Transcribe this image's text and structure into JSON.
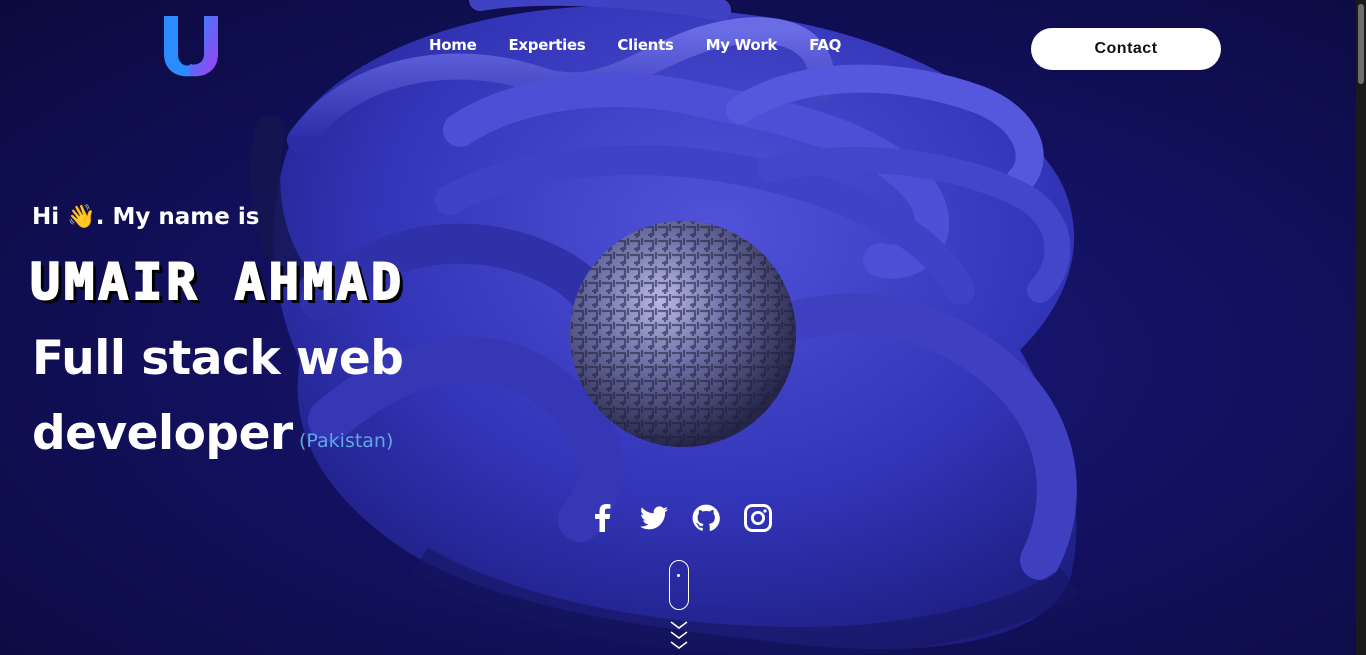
{
  "nav": {
    "items": [
      "Home",
      "Experties",
      "Clients",
      "My Work",
      "FAQ"
    ],
    "contact_label": "Contact"
  },
  "hero": {
    "greeting": "Hi 👋. My name is",
    "name": "UMAIR AHMAD",
    "title_line1": "Full stack web",
    "title_line2": "developer",
    "location": "(Pakistan)"
  },
  "socials": [
    "facebook-icon",
    "twitter-icon",
    "github-icon",
    "instagram-icon"
  ],
  "colors": {
    "background": "#131160",
    "ribbon": "#3a3bc8",
    "accent_location": "#5fa7e6",
    "logo_gradient_start": "#2a8cff",
    "logo_gradient_end": "#a23cf0"
  }
}
